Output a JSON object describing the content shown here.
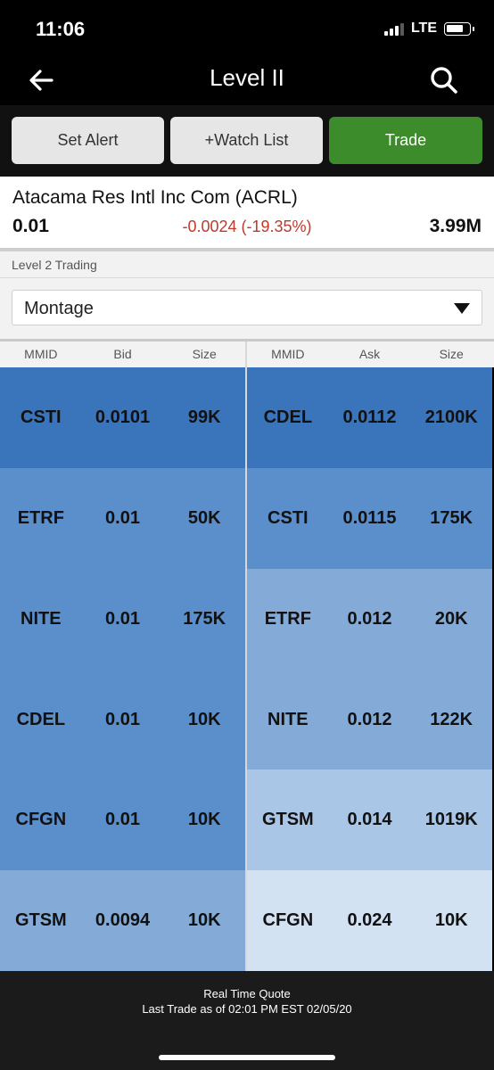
{
  "status_bar": {
    "time": "11:06",
    "network": "LTE"
  },
  "nav": {
    "title": "Level II",
    "back_icon": "arrow-left-icon",
    "search_icon": "search-icon"
  },
  "actions": {
    "set_alert": "Set Alert",
    "watch_list": "+Watch List",
    "trade": "Trade"
  },
  "quote": {
    "name": "Atacama Res Intl Inc Com (ACRL)",
    "price": "0.01",
    "change": "-0.0024 (-19.35%)",
    "volume": "3.99M"
  },
  "level2": {
    "label": "Level 2 Trading",
    "view": "Montage"
  },
  "columns": {
    "bid": [
      "MMID",
      "Bid",
      "Size"
    ],
    "ask": [
      "MMID",
      "Ask",
      "Size"
    ]
  },
  "bids": [
    {
      "mmid": "CSTI",
      "price": "0.0101",
      "size": "99K",
      "color": "#3a74bb"
    },
    {
      "mmid": "ETRF",
      "price": "0.01",
      "size": "50K",
      "color": "#5b8fcb"
    },
    {
      "mmid": "NITE",
      "price": "0.01",
      "size": "175K",
      "color": "#5b8fcb"
    },
    {
      "mmid": "CDEL",
      "price": "0.01",
      "size": "10K",
      "color": "#5b8fcb"
    },
    {
      "mmid": "CFGN",
      "price": "0.01",
      "size": "10K",
      "color": "#5b8fcb"
    },
    {
      "mmid": "GTSM",
      "price": "0.0094",
      "size": "10K",
      "color": "#84abd8"
    }
  ],
  "asks": [
    {
      "mmid": "CDEL",
      "price": "0.0112",
      "size": "2100K",
      "color": "#3a74bb"
    },
    {
      "mmid": "CSTI",
      "price": "0.0115",
      "size": "175K",
      "color": "#5b8fcb"
    },
    {
      "mmid": "ETRF",
      "price": "0.012",
      "size": "20K",
      "color": "#84abd8"
    },
    {
      "mmid": "NITE",
      "price": "0.012",
      "size": "122K",
      "color": "#84abd8"
    },
    {
      "mmid": "GTSM",
      "price": "0.014",
      "size": "1019K",
      "color": "#aac6e6"
    },
    {
      "mmid": "CFGN",
      "price": "0.024",
      "size": "10K",
      "color": "#d3e2f3"
    }
  ],
  "footer": {
    "line1": "Real Time Quote",
    "line2": "Last Trade as of 02:01 PM EST 02/05/20"
  }
}
